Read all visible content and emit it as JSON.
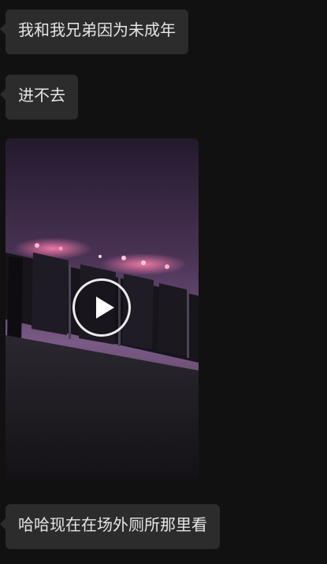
{
  "messages": [
    {
      "type": "text",
      "text": "我和我兄弟因为未成年"
    },
    {
      "type": "text",
      "text": "进不去"
    },
    {
      "type": "video",
      "icon": "play-icon"
    },
    {
      "type": "text",
      "text": "哈哈现在在场外厕所那里看"
    }
  ],
  "colors": {
    "background": "#111111",
    "bubble": "#2c2c2c",
    "text": "#e6e6e6"
  }
}
